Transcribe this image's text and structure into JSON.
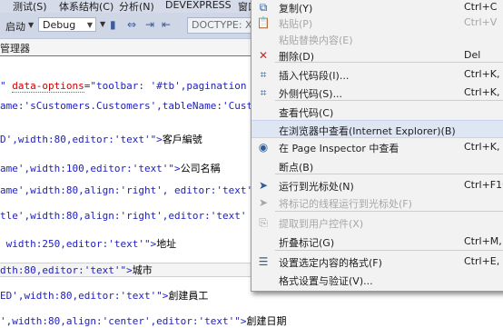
{
  "menubar": {
    "items": [
      "测试(S)",
      "体系结构(C)",
      "分析(N)",
      "DEVEXPRESS",
      "窗口"
    ]
  },
  "toolbar": {
    "start_label": "启动",
    "config_value": "Debug",
    "doctype_placeholder": "DOCTYPE: XHT"
  },
  "tab": {
    "label": "管理器"
  },
  "code": {
    "lines": [
      {
        "parts": [
          {
            "c": "s",
            "t": "\" "
          },
          {
            "c": "a",
            "t": "data-options"
          },
          {
            "c": "s",
            "t": "=\"toolbar: '#tb',pagination"
          }
        ]
      },
      {
        "parts": [
          {
            "c": "s",
            "t": "ame:'sCustomers.Customers',tableName:'Cust"
          }
        ]
      },
      {
        "parts": [
          {
            "c": "s",
            "t": "D',width:80,editor:'text'\">"
          },
          {
            "c": "t",
            "t": "客戶編號"
          }
        ]
      },
      {
        "parts": [
          {
            "c": "s",
            "t": "ame',width:100,editor:'text'\">"
          },
          {
            "c": "t",
            "t": "公司名稱"
          }
        ]
      },
      {
        "parts": [
          {
            "c": "s",
            "t": "ame',width:80,align:'right', editor:'text'"
          }
        ]
      },
      {
        "parts": [
          {
            "c": "s",
            "t": "tle',width:80,align:'right',editor:'text'"
          }
        ]
      },
      {
        "parts": [
          {
            "c": "s",
            "t": " width:250,editor:'text'\">"
          },
          {
            "c": "t",
            "t": "地址"
          }
        ]
      },
      {
        "parts": [
          {
            "c": "s",
            "t": "dth:80,editor:'text'\">"
          },
          {
            "c": "t",
            "t": "城市"
          }
        ]
      },
      {
        "parts": [
          {
            "c": "s",
            "t": "ED',width:80,editor:'text'\">"
          },
          {
            "c": "t",
            "t": "創建員工"
          }
        ]
      },
      {
        "parts": [
          {
            "c": "s",
            "t": "',width:80,align:'center',editor:'text'\">"
          },
          {
            "c": "t",
            "t": "創建日期"
          }
        ]
      }
    ]
  },
  "context_menu": {
    "items": [
      {
        "label": "复制(Y)",
        "shortcut": "Ctrl+C",
        "icon": "copy-icon",
        "glyph": "⧉",
        "enabled": true
      },
      {
        "label": "粘贴(P)",
        "shortcut": "Ctrl+V",
        "icon": "paste-icon",
        "glyph": "📋",
        "enabled": false
      },
      {
        "label": "粘贴替换内容(E)",
        "shortcut": "",
        "icon": "",
        "glyph": "",
        "enabled": false
      },
      {
        "label": "删除(D)",
        "shortcut": "Del",
        "icon": "delete-icon",
        "glyph": "✕",
        "enabled": true
      },
      {
        "label": "插入代码段(I)...",
        "shortcut": "Ctrl+K, X",
        "icon": "insert-snippet-icon",
        "glyph": "⌗",
        "enabled": true
      },
      {
        "label": "外侧代码(S)...",
        "shortcut": "Ctrl+K, S",
        "icon": "surround-with-icon",
        "glyph": "⌗",
        "enabled": true
      },
      {
        "label": "查看代码(C)",
        "shortcut": "",
        "icon": "",
        "glyph": "",
        "enabled": true
      },
      {
        "label": "在浏览器中查看(Internet Explorer)(B)",
        "shortcut": "",
        "icon": "",
        "glyph": "",
        "enabled": true,
        "highlighted": true
      },
      {
        "label": "在 Page Inspector 中查看",
        "shortcut": "Ctrl+K, G",
        "icon": "page-inspector-icon",
        "glyph": "◉",
        "enabled": true
      },
      {
        "label": "断点(B)",
        "shortcut": "",
        "icon": "",
        "glyph": "",
        "enabled": true
      },
      {
        "label": "运行到光标处(N)",
        "shortcut": "Ctrl+F10",
        "icon": "run-to-cursor-icon",
        "glyph": "➤",
        "enabled": true
      },
      {
        "label": "将标记的线程运行到光标处(F)",
        "shortcut": "",
        "icon": "run-flagged-threads-icon",
        "glyph": "➤",
        "enabled": false
      },
      {
        "label": "提取到用户控件(X)",
        "shortcut": "",
        "icon": "extract-control-icon",
        "glyph": "⎘",
        "enabled": false
      },
      {
        "label": "折叠标记(G)",
        "shortcut": "Ctrl+M, C",
        "icon": "",
        "glyph": "",
        "enabled": true
      },
      {
        "label": "设置选定内容的格式(F)",
        "shortcut": "Ctrl+E, F",
        "icon": "format-selection-icon",
        "glyph": "☰",
        "enabled": true
      },
      {
        "label": "格式设置与验证(V)...",
        "shortcut": "",
        "icon": "",
        "glyph": "",
        "enabled": true
      }
    ]
  },
  "colors": {
    "delete_icon": "#c62828",
    "highlight": "#dfe6f3",
    "accent": "#4e78b6"
  }
}
